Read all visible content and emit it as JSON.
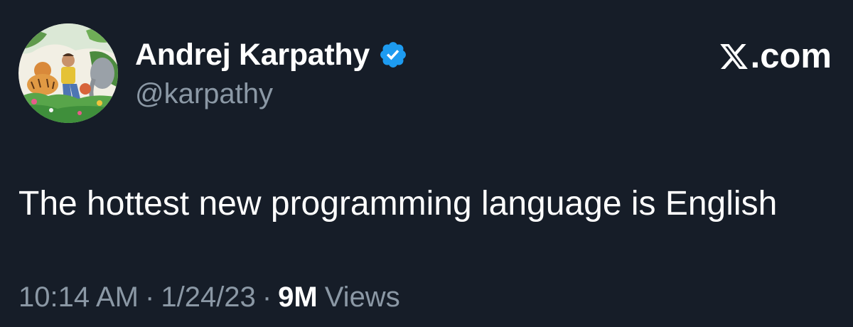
{
  "author": {
    "display_name": "Andrej Karpathy",
    "handle": "@karpathy",
    "avatar_icon": "illustrated-jungle-avatar-icon",
    "verified_icon": "verified-badge-icon",
    "verified_color": "#1d9bf0"
  },
  "brand": {
    "logo_icon": "x-logo-icon",
    "suffix": ".com"
  },
  "tweet": {
    "text": "The hottest new programming language is English"
  },
  "meta": {
    "time": "10:14 AM",
    "separator": "·",
    "date": "1/24/23",
    "views_count": "9M",
    "views_label": "Views"
  },
  "colors": {
    "background": "#161d28",
    "text_primary": "#ffffff",
    "text_secondary": "#8b98a5"
  }
}
